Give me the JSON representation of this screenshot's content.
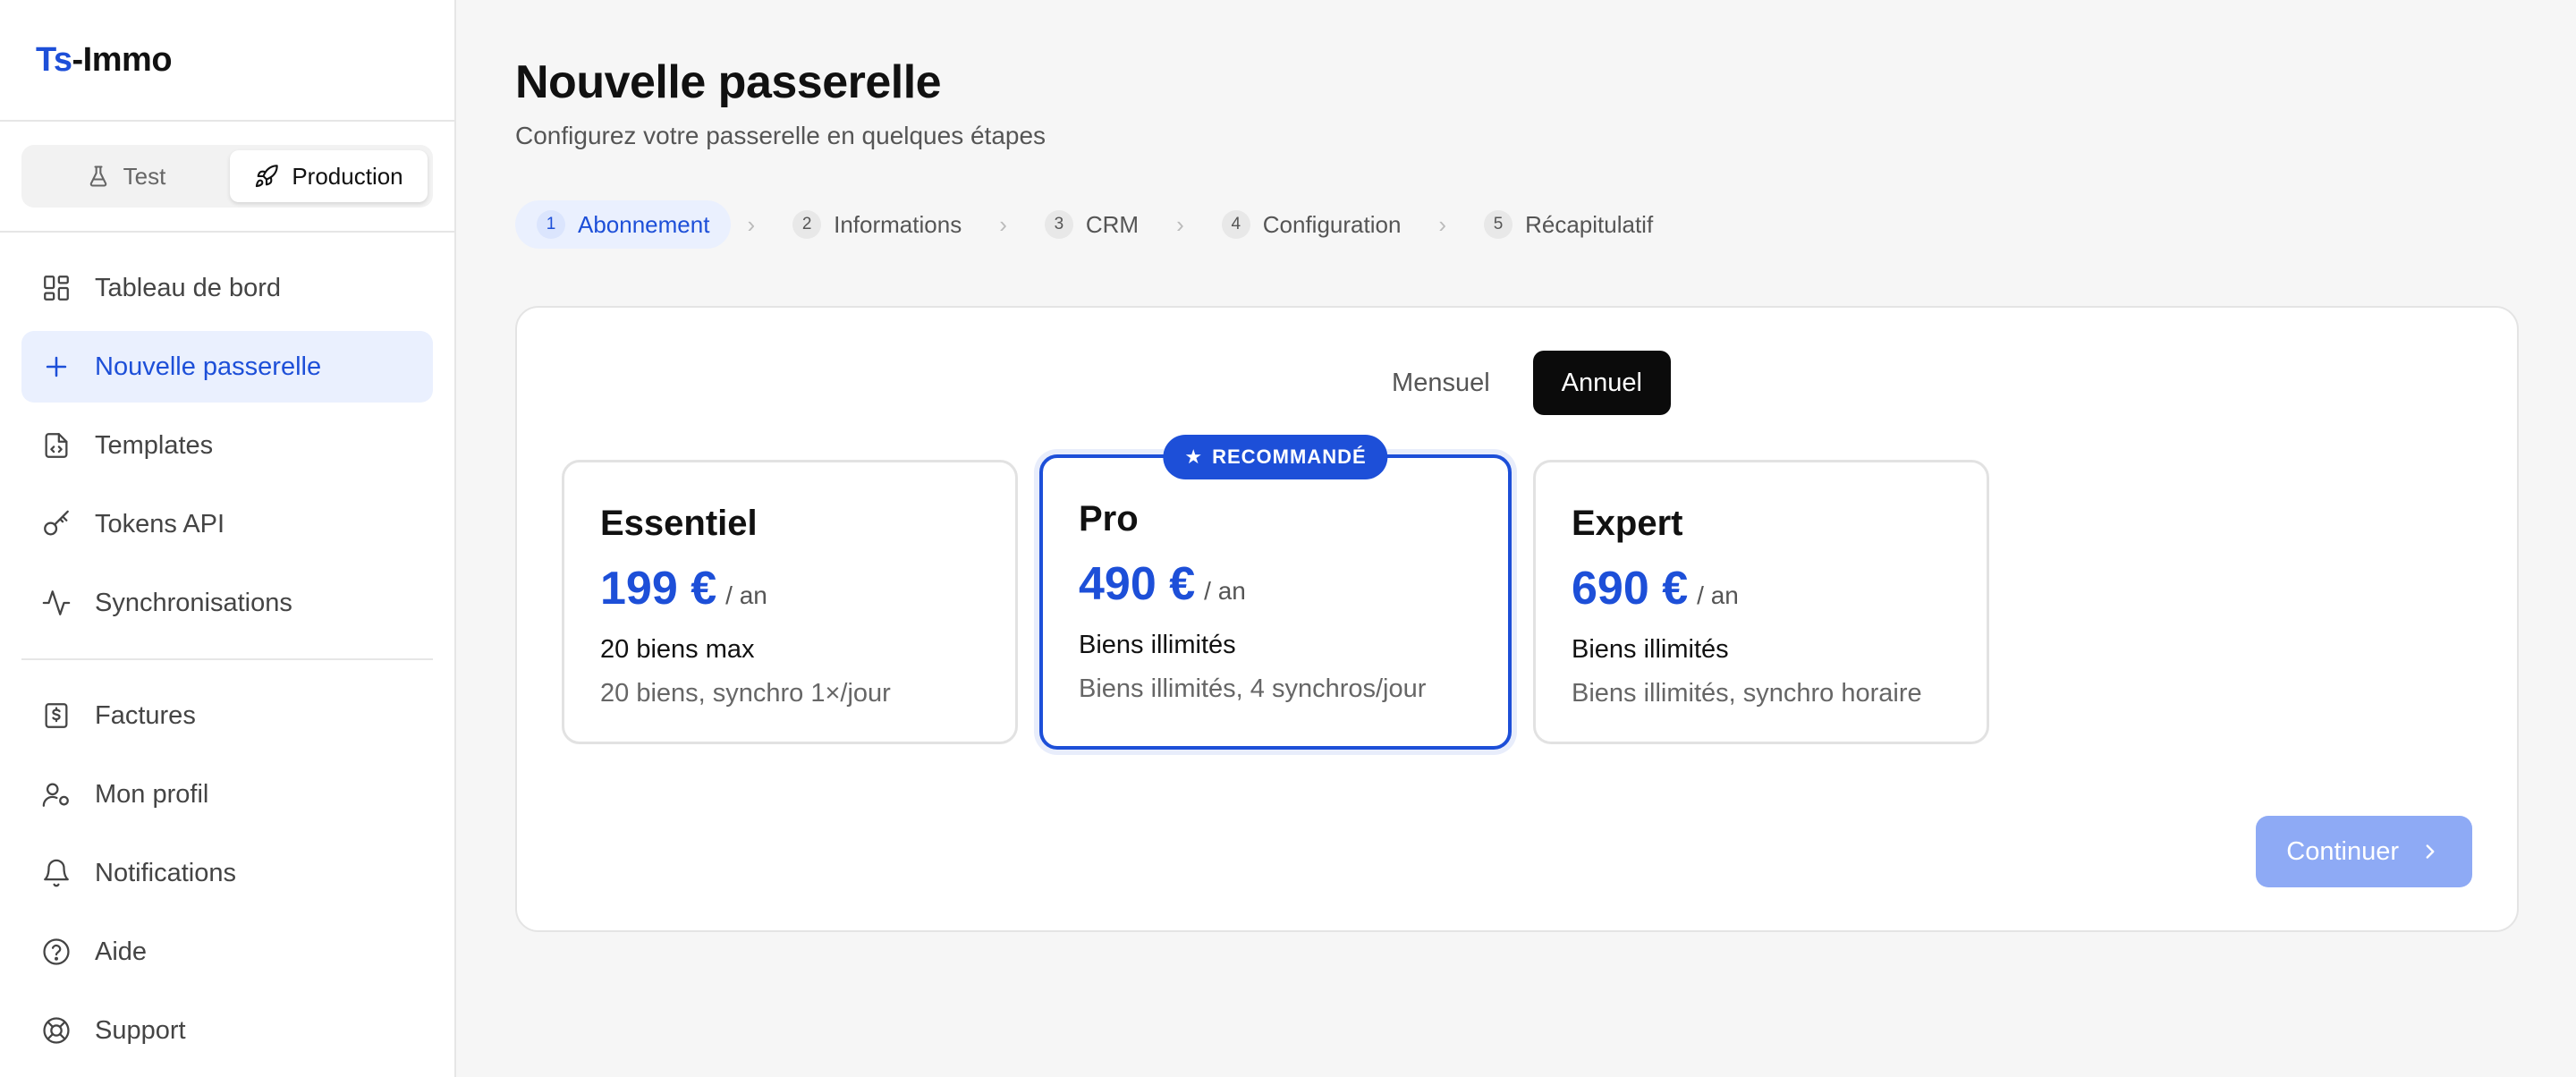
{
  "brand": {
    "part1": "Ts",
    "part2": "-Immo"
  },
  "env": {
    "test": "Test",
    "production": "Production",
    "active": "production"
  },
  "nav": {
    "primary": [
      {
        "label": "Tableau de bord",
        "icon": "dashboard-icon"
      },
      {
        "label": "Nouvelle passerelle",
        "icon": "plus-icon",
        "active": true
      },
      {
        "label": "Templates",
        "icon": "file-code-icon"
      },
      {
        "label": "Tokens API",
        "icon": "key-icon"
      },
      {
        "label": "Synchronisations",
        "icon": "activity-icon"
      }
    ],
    "secondary": [
      {
        "label": "Factures",
        "icon": "invoice-icon"
      },
      {
        "label": "Mon profil",
        "icon": "user-icon"
      },
      {
        "label": "Notifications",
        "icon": "bell-icon"
      },
      {
        "label": "Aide",
        "icon": "help-icon"
      },
      {
        "label": "Support",
        "icon": "lifebuoy-icon"
      }
    ]
  },
  "page": {
    "title": "Nouvelle passerelle",
    "subtitle": "Configurez votre passerelle en quelques étapes"
  },
  "steps": [
    {
      "num": "1",
      "label": "Abonnement",
      "active": true
    },
    {
      "num": "2",
      "label": "Informations"
    },
    {
      "num": "3",
      "label": "CRM"
    },
    {
      "num": "4",
      "label": "Configuration"
    },
    {
      "num": "5",
      "label": "Récapitulatif"
    }
  ],
  "billing": {
    "monthly": "Mensuel",
    "yearly": "Annuel",
    "active": "yearly"
  },
  "plans": [
    {
      "name": "Essentiel",
      "price": "199 €",
      "period": "/ an",
      "limit": "20 biens max",
      "desc": "20 biens, synchro 1×/jour"
    },
    {
      "name": "Pro",
      "price": "490 €",
      "period": "/ an",
      "limit": "Biens illimités",
      "desc": "Biens illimités, 4 synchros/jour",
      "badge": "RECOMMANDÉ",
      "selected": true
    },
    {
      "name": "Expert",
      "price": "690 €",
      "period": "/ an",
      "limit": "Biens illimités",
      "desc": "Biens illimités, synchro horaire"
    }
  ],
  "continue_label": "Continuer",
  "colors": {
    "accent": "#1d4fd8",
    "accent_light": "#eaf0fe",
    "button_disabled": "#8eaaf5"
  }
}
